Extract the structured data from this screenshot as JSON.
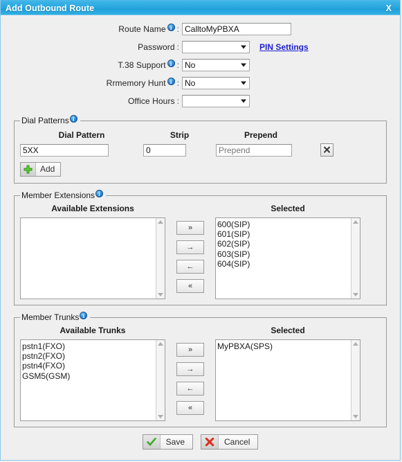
{
  "titlebar": {
    "title": "Add Outbound Route",
    "close_label": "X",
    "bg_color": "#29a7e0"
  },
  "form": {
    "fields": [
      {
        "label": "Route Name",
        "info": true,
        "type": "text",
        "value": "CalltoMyPBXA"
      },
      {
        "label": "Password",
        "info": false,
        "type": "select",
        "value": ""
      },
      {
        "label": "T.38 Support",
        "info": true,
        "type": "select",
        "value": "No"
      },
      {
        "label": "Rrmemory Hunt",
        "info": true,
        "type": "select",
        "value": "No"
      },
      {
        "label": "Office Hours",
        "info": false,
        "type": "select",
        "value": ""
      }
    ],
    "pin_settings_link": "PIN Settings"
  },
  "dial_patterns": {
    "legend": "Dial Patterns",
    "columns": [
      "Dial Pattern",
      "Strip",
      "Prepend"
    ],
    "rows": [
      {
        "pattern": "5XX",
        "strip": "0",
        "prepend": "",
        "prepend_placeholder": "Prepend"
      }
    ],
    "add_label": "Add"
  },
  "member_extensions": {
    "legend": "Member Extensions",
    "available_header": "Available Extensions",
    "selected_header": "Selected",
    "available": [],
    "selected": [
      "600(SIP)",
      "601(SIP)",
      "602(SIP)",
      "603(SIP)",
      "604(SIP)"
    ],
    "buttons": [
      "»",
      "→",
      "←",
      "«"
    ]
  },
  "member_trunks": {
    "legend": "Member Trunks",
    "available_header": "Available Trunks",
    "selected_header": "Selected",
    "available": [
      "pstn1(FXO)",
      "pstn2(FXO)",
      "pstn4(FXO)",
      "GSM5(GSM)"
    ],
    "selected": [
      "MyPBXA(SPS)"
    ],
    "buttons": [
      "»",
      "→",
      "←",
      "«"
    ]
  },
  "footer": {
    "save_label": "Save",
    "cancel_label": "Cancel"
  }
}
